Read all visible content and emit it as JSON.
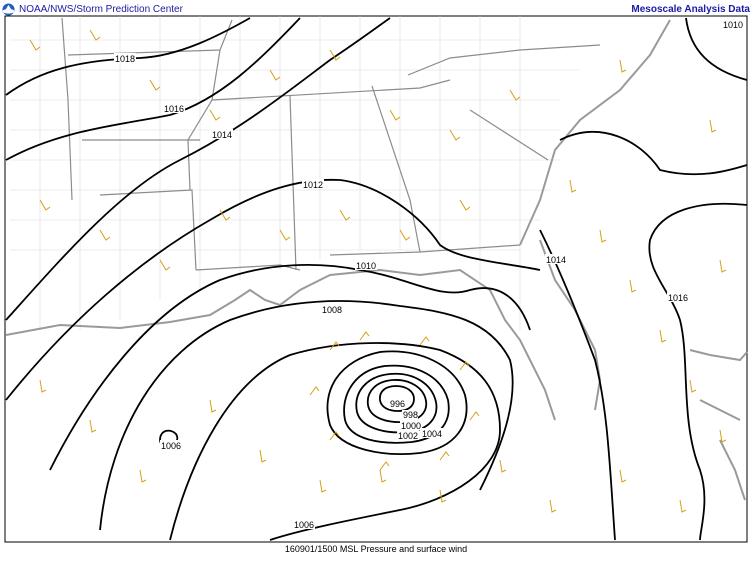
{
  "header": {
    "source": "NOAA/NWS/Storm Prediction Center",
    "product": "Mesoscale Analysis Data"
  },
  "footer": {
    "caption": "160901/1500 MSL Pressure and surface wind"
  },
  "isobar_labels": [
    {
      "value": "1018"
    },
    {
      "value": "1016"
    },
    {
      "value": "1014"
    },
    {
      "value": "1012"
    },
    {
      "value": "1010"
    },
    {
      "value": "1008"
    },
    {
      "value": "1006"
    },
    {
      "value": "1006"
    },
    {
      "value": "1004"
    },
    {
      "value": "1002"
    },
    {
      "value": "1000"
    },
    {
      "value": "998"
    },
    {
      "value": "996"
    },
    {
      "value": "1014"
    },
    {
      "value": "1016"
    },
    {
      "value": "1010"
    }
  ],
  "colors": {
    "isobar": "#000000",
    "coast": "#9a9a9a",
    "county": "#d6d6d6",
    "wind_barb": "#d4a017",
    "header_text": "#1a1aa6"
  },
  "icons": {
    "logo": "noaa-logo-icon"
  }
}
